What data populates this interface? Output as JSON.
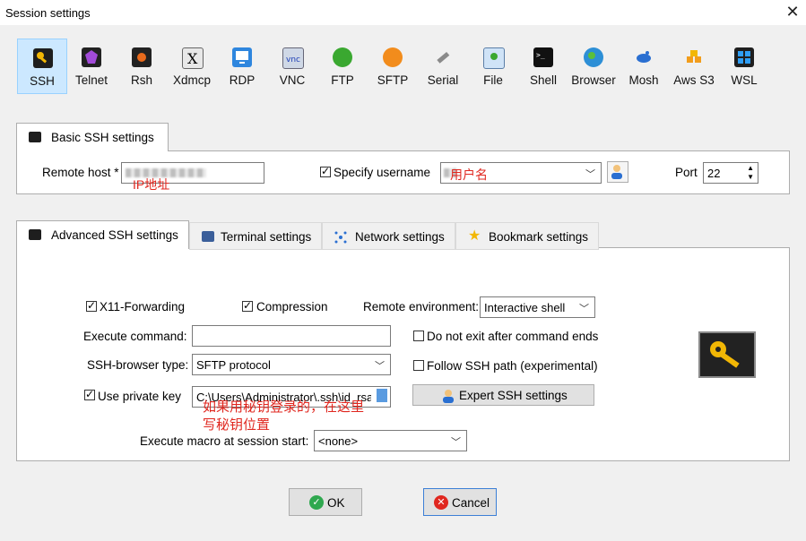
{
  "window": {
    "title": "Session settings",
    "close": "✕"
  },
  "protocols": [
    "SSH",
    "Telnet",
    "Rsh",
    "Xdmcp",
    "RDP",
    "VNC",
    "FTP",
    "SFTP",
    "Serial",
    "File",
    "Shell",
    "Browser",
    "Mosh",
    "Aws S3",
    "WSL"
  ],
  "basic": {
    "tab_label": "Basic SSH settings",
    "remote_host_label": "Remote host *",
    "ip_note": "IP地址",
    "specify_username_label": "Specify username",
    "username_note": "用户名",
    "port_label": "Port",
    "port_value": "22"
  },
  "tabs": [
    "Advanced SSH settings",
    "Terminal settings",
    "Network settings",
    "Bookmark settings"
  ],
  "advanced": {
    "x11": "X11-Forwarding",
    "compression": "Compression",
    "remote_env_label": "Remote environment:",
    "remote_env_value": "Interactive shell",
    "exec_cmd_label": "Execute command:",
    "no_exit_label": "Do not exit after command ends",
    "browser_type_label": "SSH-browser type:",
    "browser_type_value": "SFTP protocol",
    "follow_path_label": "Follow SSH path (experimental)",
    "private_key_label": "Use private key",
    "private_key_value": "C:\\Users\\Administrator\\.ssh\\id_rsa",
    "expert_label": "Expert SSH settings",
    "note_line1": "如果用秘钥登录的，在这里",
    "note_line2": "写秘钥位置",
    "macro_label": "Execute macro at session start:",
    "macro_value": "<none>"
  },
  "buttons": {
    "ok": "OK",
    "cancel": "Cancel"
  },
  "colors": {
    "selection": "#cce8ff",
    "annotation": "#e0271f",
    "key_gold": "#f2b705"
  }
}
